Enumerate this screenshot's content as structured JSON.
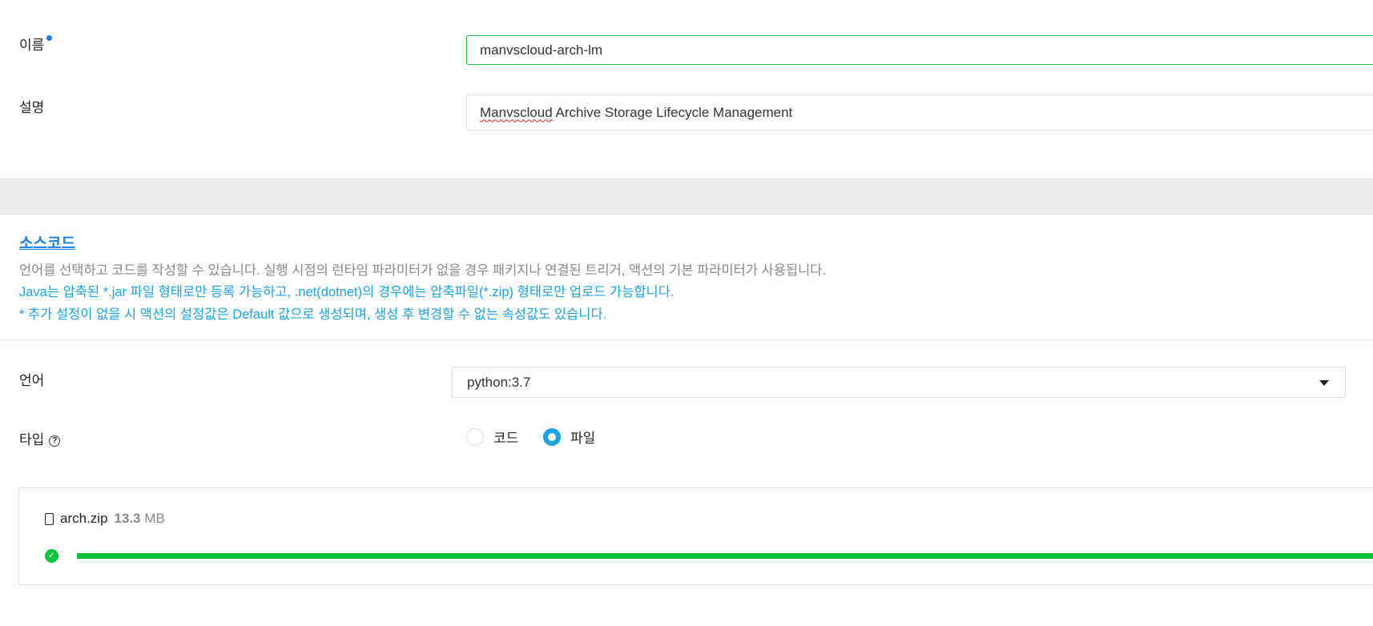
{
  "form": {
    "name_label": "이름",
    "name_value": "manvscloud-arch-lm",
    "desc_label": "설명",
    "desc_value_word1": "Manvscloud",
    "desc_value_rest": " Archive Storage Lifecycle Management"
  },
  "source": {
    "title": "소스코드",
    "line1": "언어를 선택하고 코드를 작성할 수 있습니다. 실행 시점의 런타임 파라미터가 없을 경우 패키지나 연결된 트리거, 액션의 기본 파라미터가 사용됩니다.",
    "line2": "Java는 압축된 *.jar 파일 형태로만 등록 가능하고, .net(dotnet)의 경우에는 압축파일(*.zip) 형태로만 업로드 가능합니다.",
    "line3": "* 추가 설정이 없을 시 액션의 설정값은 Default 값으로 생성되며, 생성 후 변경할 수 없는 속성값도 있습니다.",
    "language_label": "언어",
    "language_value": "python:3.7",
    "type_label": "타입",
    "type_options": [
      "코드",
      "파일"
    ],
    "type_selected": "파일"
  },
  "upload": {
    "file_name": "arch.zip",
    "size_value": "13.3",
    "size_unit": "MB",
    "progress_percent": 100,
    "status": "complete"
  },
  "colors": {
    "accent": "#1a7fe0",
    "info": "#1aa3e8",
    "success": "#00c43b"
  }
}
